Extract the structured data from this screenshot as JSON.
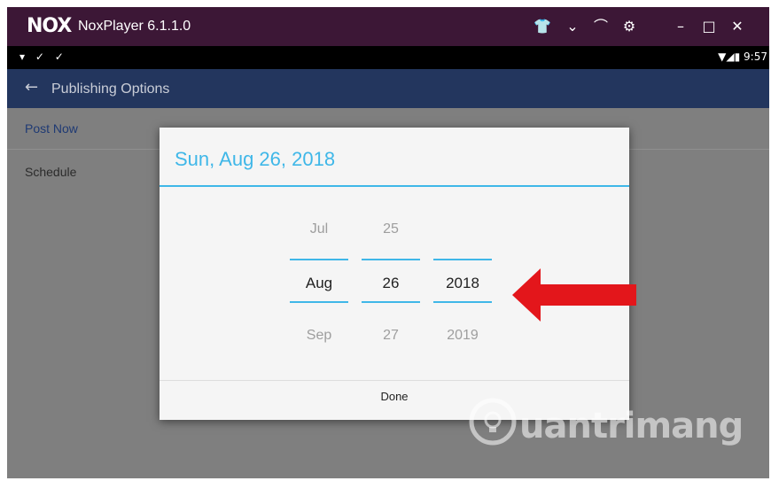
{
  "window": {
    "logo": "NOX",
    "title": "NoxPlayer 6.1.1.0",
    "controls": [
      "shirt-icon",
      "chevron-down-icon",
      "pin-icon",
      "gear-icon",
      "minimize-icon",
      "maximize-icon",
      "close-icon"
    ]
  },
  "statusbar": {
    "left_icons": "▾ ✓ ✓",
    "right_text": "▼◢▮ 9:57"
  },
  "appbar": {
    "back_icon": "←",
    "title": "Publishing Options"
  },
  "options": {
    "post_now": "Post Now",
    "schedule": "Schedule"
  },
  "dialog": {
    "selected_date": "Sun, Aug 26, 2018",
    "month": {
      "prev": "Jul",
      "current": "Aug",
      "next": "Sep"
    },
    "day": {
      "prev": "25",
      "current": "26",
      "next": "27"
    },
    "year": {
      "prev": "",
      "current": "2018",
      "next": "2019"
    },
    "done_label": "Done"
  },
  "colors": {
    "accent": "#3fb7e8",
    "titlebar": "#3c1736",
    "appbar": "#23365e",
    "arrow": "#e3161b"
  },
  "watermark": {
    "text": "uantrimang"
  }
}
